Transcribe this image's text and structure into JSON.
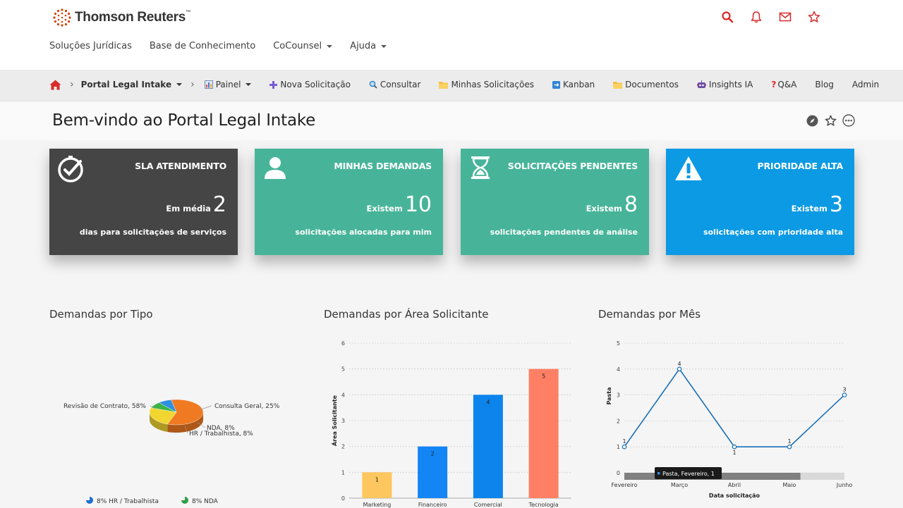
{
  "brand": {
    "name": "Thomson Reuters",
    "tm": "™"
  },
  "top_icons": [
    "search-icon",
    "bell-icon",
    "mail-icon",
    "star-icon"
  ],
  "main_nav": [
    {
      "label": "Soluções Jurídicas",
      "dropdown": false
    },
    {
      "label": "Base de Conhecimento",
      "dropdown": false
    },
    {
      "label": "CoCounsel",
      "dropdown": true
    },
    {
      "label": "Ajuda",
      "dropdown": true
    }
  ],
  "subnav": {
    "portal": "Portal Legal Intake",
    "items": [
      {
        "label": "Painel",
        "icon": "bar-chart-icon",
        "dropdown": true
      },
      {
        "label": "Nova Solicitação",
        "icon": "plus-icon",
        "dropdown": false
      },
      {
        "label": "Consultar",
        "icon": "magnifier-icon",
        "dropdown": false
      },
      {
        "label": "Minhas Solicitações",
        "icon": "folder-icon",
        "dropdown": false
      },
      {
        "label": "Kanban",
        "icon": "kanban-icon",
        "dropdown": false
      },
      {
        "label": "Documentos",
        "icon": "folder-icon",
        "dropdown": false
      },
      {
        "label": "Insights IA",
        "icon": "robot-icon",
        "dropdown": false
      },
      {
        "label": "Q&A",
        "icon": "question-icon",
        "dropdown": false
      },
      {
        "label": "Blog",
        "icon": "",
        "dropdown": false
      },
      {
        "label": "Admin",
        "icon": "",
        "dropdown": false
      }
    ]
  },
  "page": {
    "title": "Bem-vindo ao Portal Legal Intake"
  },
  "cards": [
    {
      "title": "SLA ATENDIMENTO",
      "prefix": "Em média",
      "value": "2",
      "subtitle": "dias para solicitações de serviços",
      "color": "#454545",
      "icon": "clock-check-icon"
    },
    {
      "title": "MINHAS DEMANDAS",
      "prefix": "Existem",
      "value": "10",
      "subtitle": "solicitações alocadas para mim",
      "color": "#47b49a",
      "icon": "user-icon"
    },
    {
      "title": "SOLICITAÇÕES PENDENTES",
      "prefix": "Existem",
      "value": "8",
      "subtitle": "solicitações pendentes de análise",
      "color": "#47b49a",
      "icon": "hourglass-icon"
    },
    {
      "title": "PRIORIDADE ALTA",
      "prefix": "Existem",
      "value": "3",
      "subtitle": "solicitações com prioridade alta",
      "color": "#0b9ae3",
      "icon": "warning-icon"
    }
  ],
  "charts": {
    "by_type_title": "Demandas por Tipo",
    "by_area_title": "Demandas por Área Solicitante",
    "by_month_title": "Demandas por Mês"
  },
  "chart_data": [
    {
      "type": "pie",
      "title": "Demandas por Tipo",
      "slices": [
        {
          "label": "Revisão de Contrato",
          "value": 58,
          "color": "#f07a22"
        },
        {
          "label": "Consulta Geral",
          "value": 25,
          "color": "#f2d630"
        },
        {
          "label": "NDA",
          "value": 8,
          "color": "#3db34a"
        },
        {
          "label": "HR / Trabalhista",
          "value": 8,
          "color": "#2f8fe0"
        }
      ],
      "slice_labels": [
        "Revisão de Contrato, 58%",
        "Consulta Geral, 25%",
        "NDA, 8%",
        "HR / Trabalhista, 8%"
      ],
      "legend": [
        {
          "label": "8% HR / Trabalhista",
          "color": "#1e6fd0"
        },
        {
          "label": "8% NDA",
          "color": "#2f9e44"
        }
      ]
    },
    {
      "type": "bar",
      "title": "Demandas por Área Solicitante",
      "categories": [
        "Marketing",
        "Financeiro",
        "Comercial",
        "Tecnologia"
      ],
      "values": [
        1,
        2,
        4,
        5
      ],
      "colors": [
        "#fdc65e",
        "#1485f5",
        "#0c84ec",
        "#fe7f64"
      ],
      "ylabel": "Área Solicitante",
      "ylim": [
        0,
        6
      ],
      "yticks": [
        "0",
        "1",
        "2",
        "3",
        "4",
        "5",
        "6"
      ],
      "grid": true
    },
    {
      "type": "line",
      "title": "Demandas por Mês",
      "x": [
        "Fevereiro",
        "Março",
        "Abril",
        "Maio",
        "Junho"
      ],
      "values": [
        1,
        4,
        1,
        1,
        3
      ],
      "xlabel": "Data solicitação",
      "ylabel": "Pasta",
      "ylim": [
        0,
        5
      ],
      "yticks": [
        "0",
        "1",
        "2",
        "3",
        "4",
        "5"
      ],
      "series_name": "Pasta",
      "tooltip": "Pasta, Fevereiro, 1",
      "color": "#1b6fb5",
      "grid": true
    }
  ]
}
